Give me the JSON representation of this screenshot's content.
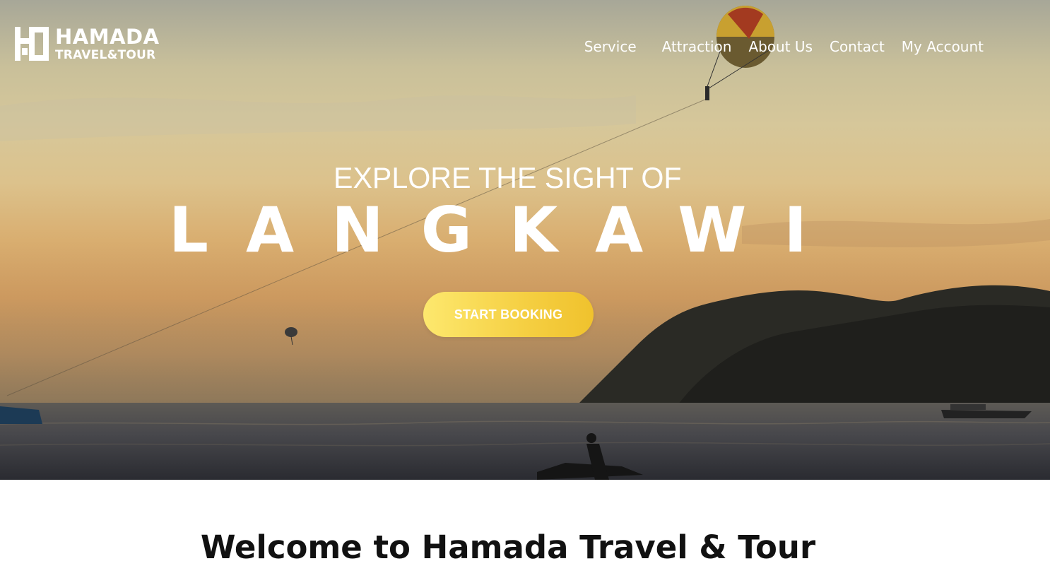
{
  "brand": {
    "name": "HAMADA",
    "subtitle": "TRAVEL&TOUR"
  },
  "nav": {
    "items": [
      {
        "label": "Service"
      },
      {
        "label": "Attraction"
      },
      {
        "label": "About Us"
      },
      {
        "label": "Contact"
      },
      {
        "label": "My Account"
      }
    ]
  },
  "hero": {
    "eyebrow": "EXPLORE THE SIGHT OF",
    "title": "LANGKAWI",
    "cta_label": "START BOOKING"
  },
  "welcome": {
    "heading": "Welcome to Hamada Travel & Tour"
  },
  "colors": {
    "cta_start": "#fde86e",
    "cta_end": "#f0c22d",
    "text_light": "#ffffff",
    "heading_dark": "#111111"
  }
}
